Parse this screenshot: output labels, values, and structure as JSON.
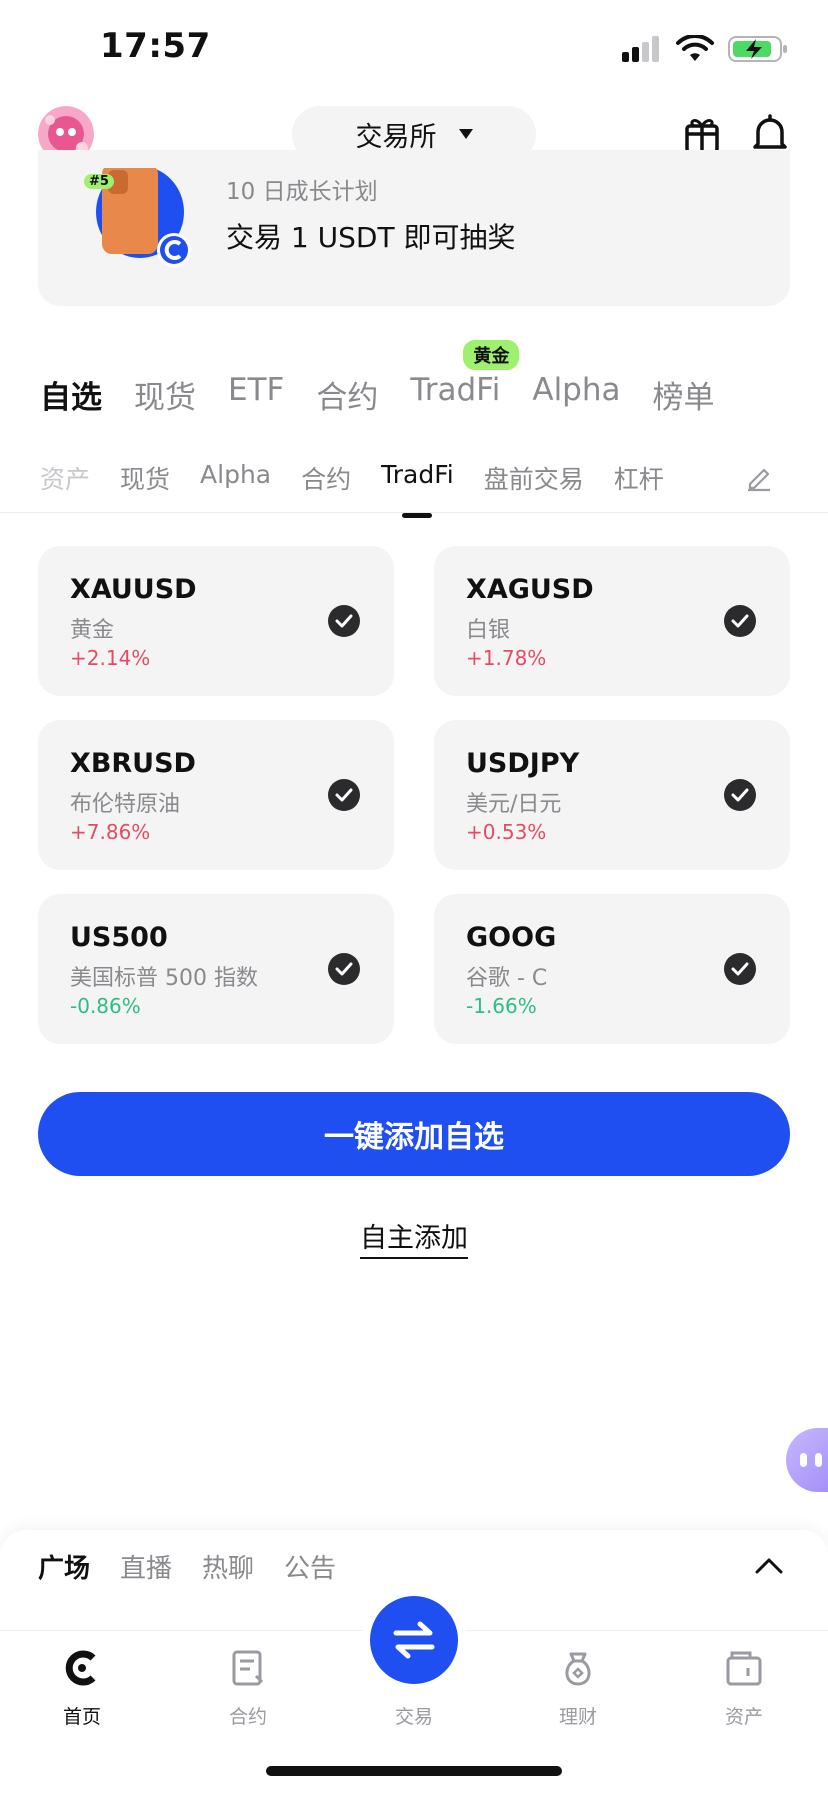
{
  "status_bar": {
    "time": "17:57"
  },
  "header": {
    "exchange_label": "交易所"
  },
  "promo": {
    "badge": "#5",
    "subtitle": "10 日成长计划",
    "title": "交易 1 USDT 即可抽奖"
  },
  "tabs_primary": [
    {
      "label": "自选",
      "active": true
    },
    {
      "label": "现货"
    },
    {
      "label": "ETF"
    },
    {
      "label": "合约"
    },
    {
      "label": "TradFi",
      "badge": "黄金"
    },
    {
      "label": "Alpha"
    },
    {
      "label": "榜单"
    }
  ],
  "tabs_secondary": [
    {
      "label": "资产"
    },
    {
      "label": "现货"
    },
    {
      "label": "Alpha"
    },
    {
      "label": "合约"
    },
    {
      "label": "TradFi",
      "active": true
    },
    {
      "label": "盘前交易"
    },
    {
      "label": "杠杆"
    }
  ],
  "assets": [
    {
      "symbol": "XAUUSD",
      "name": "黄金",
      "change": "+2.14%",
      "direction": "up"
    },
    {
      "symbol": "XAGUSD",
      "name": "白银",
      "change": "+1.78%",
      "direction": "up"
    },
    {
      "symbol": "XBRUSD",
      "name": "布伦特原油",
      "change": "+7.86%",
      "direction": "up"
    },
    {
      "symbol": "USDJPY",
      "name": "美元/日元",
      "change": "+0.53%",
      "direction": "up"
    },
    {
      "symbol": "US500",
      "name": "美国标普 500 指数",
      "change": "-0.86%",
      "direction": "down"
    },
    {
      "symbol": "GOOG",
      "name": "谷歌 - C",
      "change": "-1.66%",
      "direction": "down"
    }
  ],
  "actions": {
    "add_all": "一键添加自选",
    "add_manual": "自主添加"
  },
  "feed_tabs": [
    {
      "label": "广场",
      "active": true
    },
    {
      "label": "直播"
    },
    {
      "label": "热聊"
    },
    {
      "label": "公告"
    }
  ],
  "bottom_nav": {
    "home": "首页",
    "futures": "合约",
    "trade": "交易",
    "earn": "理财",
    "assets": "资产"
  },
  "colors": {
    "accent": "#1f4ff0",
    "up": "#e84a66",
    "down": "#2ebd85",
    "badge": "#9ef06e"
  },
  "icons": [
    "signal-icon",
    "wifi-icon",
    "battery-icon",
    "gift-icon",
    "bell-icon",
    "edit-icon",
    "check-icon",
    "chevron-up-icon",
    "home-icon",
    "futures-icon",
    "swap-icon",
    "earn-icon",
    "wallet-icon"
  ]
}
